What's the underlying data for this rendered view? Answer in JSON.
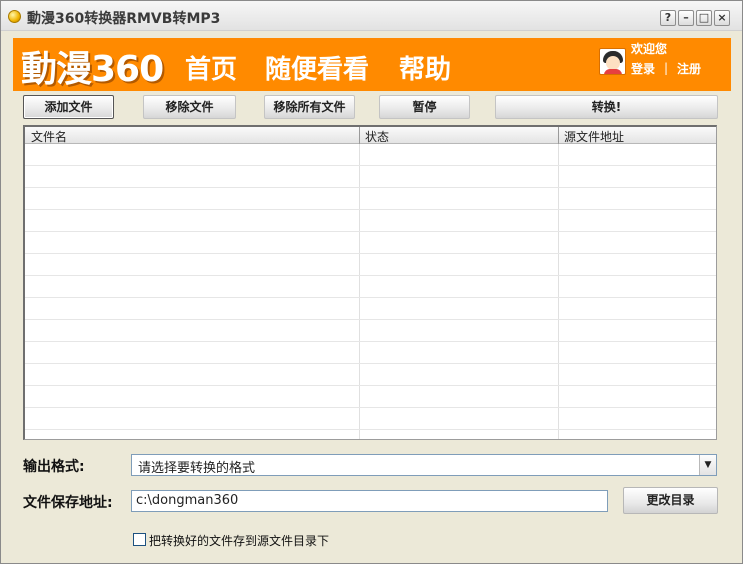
{
  "window": {
    "title": "動漫360转换器RMVB转MP3",
    "controls": {
      "help": "?",
      "minimize": "–",
      "maximize": "□",
      "close": "×"
    }
  },
  "banner": {
    "brand": "動漫360",
    "nav": [
      "首页",
      "随便看看",
      "帮助"
    ],
    "welcome": "欢迎您",
    "login": "登录",
    "separator": "|",
    "register": "注册"
  },
  "toolbar": {
    "add_file": "添加文件",
    "remove_file": "移除文件",
    "remove_all": "移除所有文件",
    "pause": "暂停",
    "convert": "转换!"
  },
  "file_list": {
    "columns": [
      "文件名",
      "状态",
      "源文件地址"
    ],
    "rows": []
  },
  "form": {
    "output_format_label": "输出格式:",
    "output_format_value": "请选择要转换的格式",
    "save_path_label": "文件保存地址:",
    "save_path_value": "c:\\dongman360",
    "change_dir_button": "更改目录",
    "save_to_source_label": "把转换好的文件存到源文件目录下",
    "save_to_source_checked": false
  },
  "colors": {
    "banner": "#ff8a00",
    "window_bg": "#ece9d8"
  }
}
